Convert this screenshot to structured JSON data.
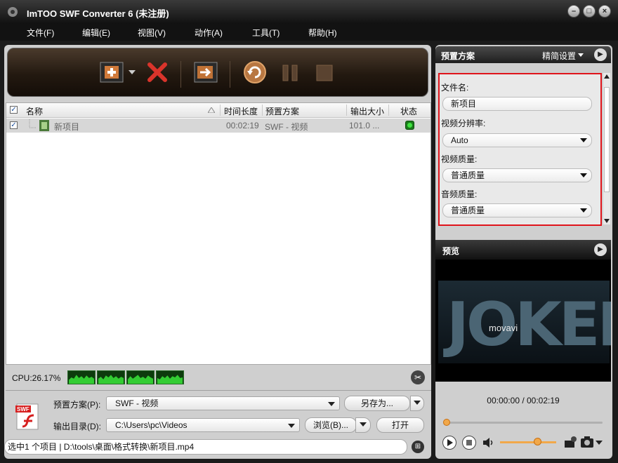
{
  "window": {
    "title": "ImTOO SWF Converter 6 (未注册)"
  },
  "menu": [
    "文件(F)",
    "编辑(E)",
    "视图(V)",
    "动作(A)",
    "工具(T)",
    "帮助(H)"
  ],
  "toolbar": {
    "icons": [
      "add-file-icon",
      "remove-icon",
      "add-to-output-icon",
      "convert-icon",
      "pause-icon",
      "stop-icon"
    ]
  },
  "file_list": {
    "columns": [
      "名称",
      "时间长度",
      "预置方案",
      "输出大小",
      "状态"
    ],
    "rows": [
      {
        "checked": true,
        "name": "新项目",
        "duration": "00:02:19",
        "profile": "SWF - 视频",
        "size": "101.0 ...",
        "status_color": "#3fe23f"
      }
    ]
  },
  "cpu": {
    "label": "CPU:26.17%"
  },
  "bottom": {
    "profile_label": "预置方案(P):",
    "profile_value": "SWF - 视频",
    "save_as_label": "另存为...",
    "output_label": "输出目录(D):",
    "output_value": "C:\\Users\\pc\\Videos",
    "browse_label": "浏览(B)...",
    "open_label": "打开"
  },
  "statusbar": {
    "text": "选中1 个项目 | D:\\tools\\桌面\\格式转换\\新项目.mp4"
  },
  "profile_panel": {
    "title": "预置方案",
    "advanced_label": "精简设置",
    "fields": {
      "filename_label": "文件名:",
      "filename_value": "新项目",
      "resolution_label": "视频分辨率:",
      "resolution_value": "Auto",
      "video_quality_label": "视频质量:",
      "video_quality_value": "普通质量",
      "audio_quality_label": "音频质量:",
      "audio_quality_value": "普通质量"
    },
    "highlight_color": "#e0141b"
  },
  "preview": {
    "title": "预览",
    "frame_text": "JOKER",
    "watermark": "movavi",
    "time": "00:00:00 / 00:02:19"
  }
}
